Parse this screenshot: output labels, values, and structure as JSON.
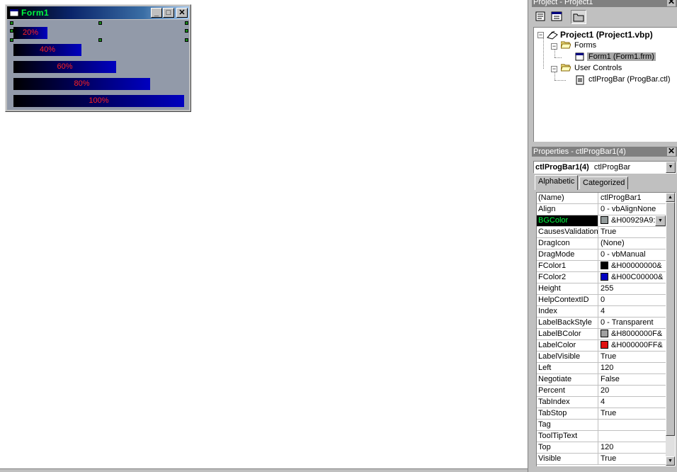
{
  "form": {
    "title": "Form1",
    "minimize_glyph": "_",
    "maximize_glyph": "□",
    "close_glyph": "✕",
    "progress_bars": [
      {
        "label": "20%",
        "percent": 20
      },
      {
        "label": "40%",
        "percent": 40
      },
      {
        "label": "60%",
        "percent": 60
      },
      {
        "label": "80%",
        "percent": 80
      },
      {
        "label": "100%",
        "percent": 100
      }
    ],
    "colors": {
      "background": "#929aa9",
      "bar_start": "#000000",
      "bar_end": "#0000c0",
      "label": "#ff2020"
    }
  },
  "project": {
    "title": "Project - Project1",
    "tree": {
      "root": "Project1 (Project1.vbp)",
      "forms_folder": "Forms",
      "form_item": "Form1 (Form1.frm)",
      "controls_folder": "User Controls",
      "control_item": "ctlProgBar (ProgBar.ctl)"
    }
  },
  "properties": {
    "title": "Properties - ctlProgBar1(4)",
    "object_name": "ctlProgBar1(4)",
    "object_type": "ctlProgBar",
    "tabs": [
      "Alphabetic",
      "Categorized"
    ],
    "active_tab": "Alphabetic",
    "rows": [
      {
        "name": "(Name)",
        "value": "ctlProgBar1"
      },
      {
        "name": "Align",
        "value": "0 - vbAlignNone"
      },
      {
        "name": "BGColor",
        "value": "&H00929A9:",
        "swatch": "#929a9a",
        "selected": true
      },
      {
        "name": "CausesValidation",
        "value": "True"
      },
      {
        "name": "DragIcon",
        "value": "(None)"
      },
      {
        "name": "DragMode",
        "value": "0 - vbManual"
      },
      {
        "name": "FColor1",
        "value": "&H00000000&",
        "swatch": "#000000"
      },
      {
        "name": "FColor2",
        "value": "&H00C00000&",
        "swatch": "#0000c0"
      },
      {
        "name": "Height",
        "value": "255"
      },
      {
        "name": "HelpContextID",
        "value": "0"
      },
      {
        "name": "Index",
        "value": "4"
      },
      {
        "name": "LabelBackStyle",
        "value": "0 - Transparent"
      },
      {
        "name": "LabelBColor",
        "value": "&H8000000F&",
        "swatch": "#a0a0a0"
      },
      {
        "name": "LabelColor",
        "value": "&H000000FF&",
        "swatch": "#e01010"
      },
      {
        "name": "LabelVisible",
        "value": "True"
      },
      {
        "name": "Left",
        "value": "120"
      },
      {
        "name": "Negotiate",
        "value": "False"
      },
      {
        "name": "Percent",
        "value": "20"
      },
      {
        "name": "TabIndex",
        "value": "4"
      },
      {
        "name": "TabStop",
        "value": "True"
      },
      {
        "name": "Tag",
        "value": ""
      },
      {
        "name": "ToolTipText",
        "value": ""
      },
      {
        "name": "Top",
        "value": "120"
      },
      {
        "name": "Visible",
        "value": "True"
      }
    ]
  }
}
